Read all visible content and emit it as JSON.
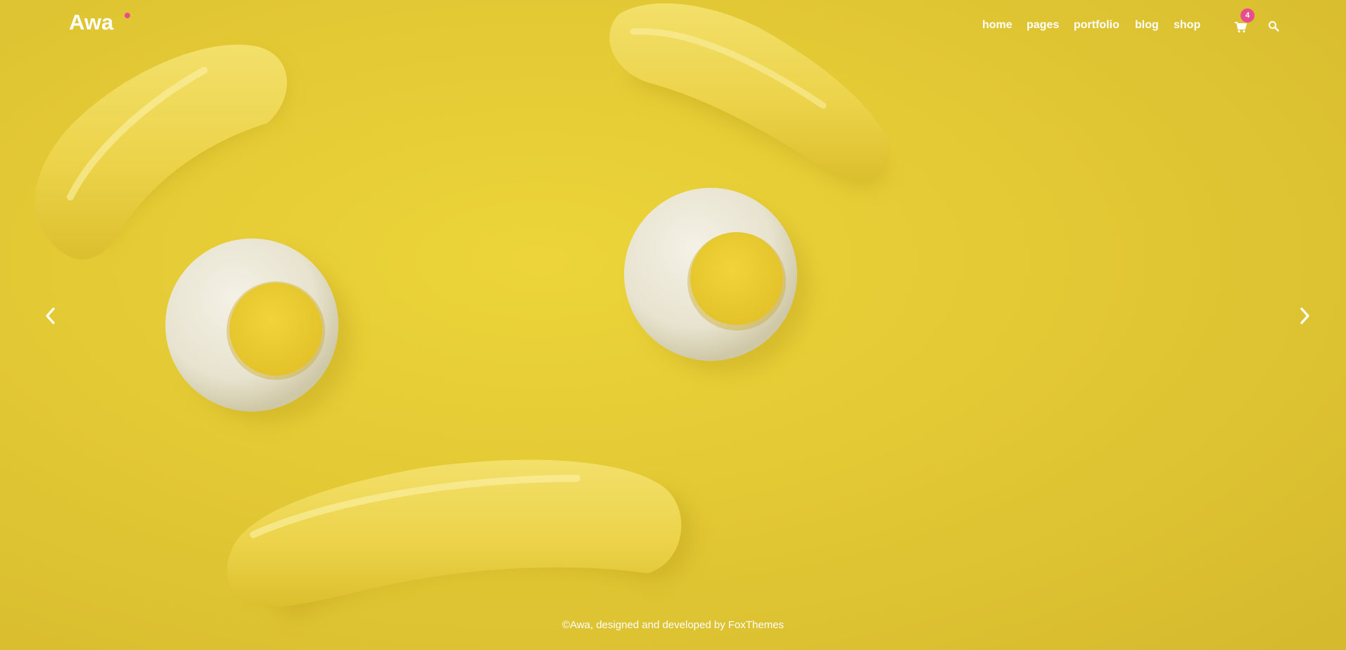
{
  "brand": {
    "name": "Awa",
    "accent_color": "#e94e8c"
  },
  "nav": {
    "items": [
      {
        "label": "home"
      },
      {
        "label": "pages"
      },
      {
        "label": "portfolio"
      },
      {
        "label": "blog"
      },
      {
        "label": "shop"
      }
    ],
    "cart_icon": "cart-icon",
    "cart_count": "4",
    "search_icon": "search-icon"
  },
  "slider": {
    "prev_icon": "chevron-left-icon",
    "next_icon": "chevron-right-icon",
    "background_color": "#e3c934"
  },
  "footer": {
    "text": "©Awa, designed and developed by FoxThemes"
  }
}
